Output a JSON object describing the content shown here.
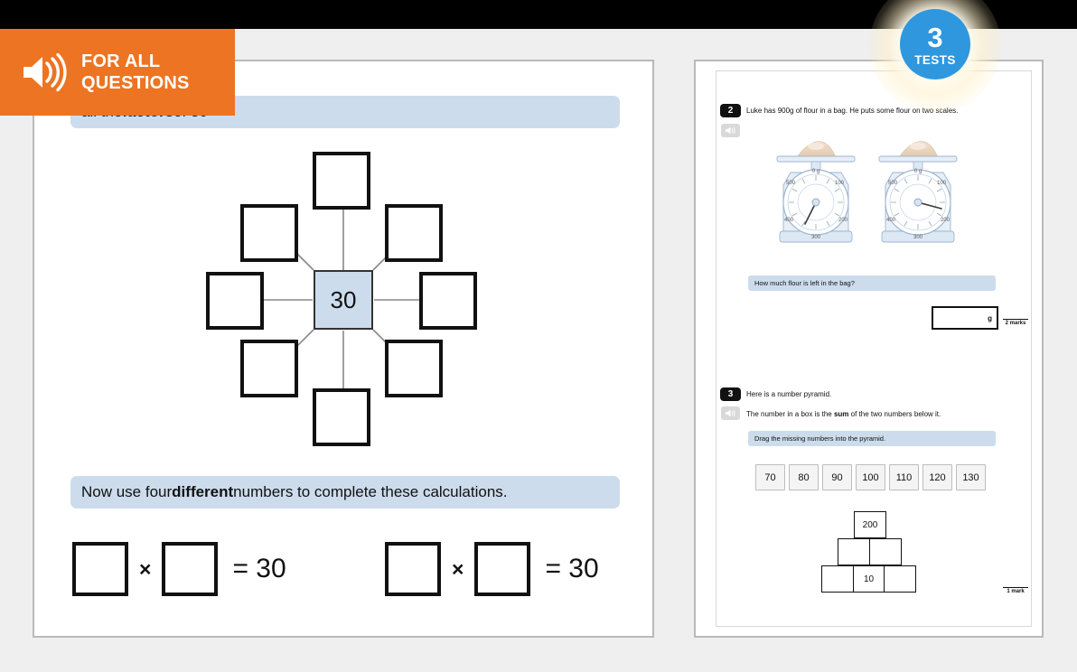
{
  "badge": {
    "count": "3",
    "label": "TESTS"
  },
  "audio_banner": {
    "line1": "FOR ALL",
    "line2": "QUESTIONS",
    "icon": "speaker-icon",
    "color": "#ec7422"
  },
  "left_page": {
    "question_banner": {
      "text_before_bold": "all the ",
      "bold": "factors",
      "text_after_bold": " of 30"
    },
    "factor_web": {
      "center_value": "30",
      "center_fill": "#ccdcec",
      "outer_box_count": 8,
      "outer_box_values": [
        "",
        "",
        "",
        "",
        "",
        "",
        "",
        ""
      ]
    },
    "calc_banner": {
      "text_before_bold": "Now use four ",
      "bold": "different",
      "text_after_bold": " numbers to complete these calculations."
    },
    "calculations": [
      {
        "operand_a": "",
        "symbol": "×",
        "operand_b": "",
        "equals": "= 30"
      },
      {
        "operand_a": "",
        "symbol": "×",
        "operand_b": "",
        "equals": "= 30"
      }
    ]
  },
  "right_page": {
    "question2": {
      "number": "2",
      "speaker_icon": "speaker-icon",
      "prompt": "Luke has 900g of flour in a bag. He puts some flour on two scales.",
      "scales": {
        "dial_labels": [
          "0 g",
          "100",
          "200",
          "300",
          "400",
          "500"
        ],
        "left_reading": 350,
        "right_reading": 150
      },
      "sub_prompt": "How much flour is left in the bag?",
      "answer_value": "",
      "answer_unit": "g",
      "marks": "2 marks"
    },
    "question3": {
      "number": "3",
      "speaker_icon": "speaker-icon",
      "line1": "Here is a number pyramid.",
      "line2_before_bold": "The number in a box is the ",
      "line2_bold": "sum",
      "line2_after_bold": " of the two numbers below it.",
      "instruction": "Drag the missing numbers into the pyramid.",
      "tiles": [
        "70",
        "80",
        "90",
        "100",
        "110",
        "120",
        "130"
      ],
      "pyramid": {
        "top": [
          "200"
        ],
        "middle": [
          "",
          ""
        ],
        "bottom": [
          "",
          "10",
          ""
        ]
      },
      "marks": "1 mark"
    }
  }
}
